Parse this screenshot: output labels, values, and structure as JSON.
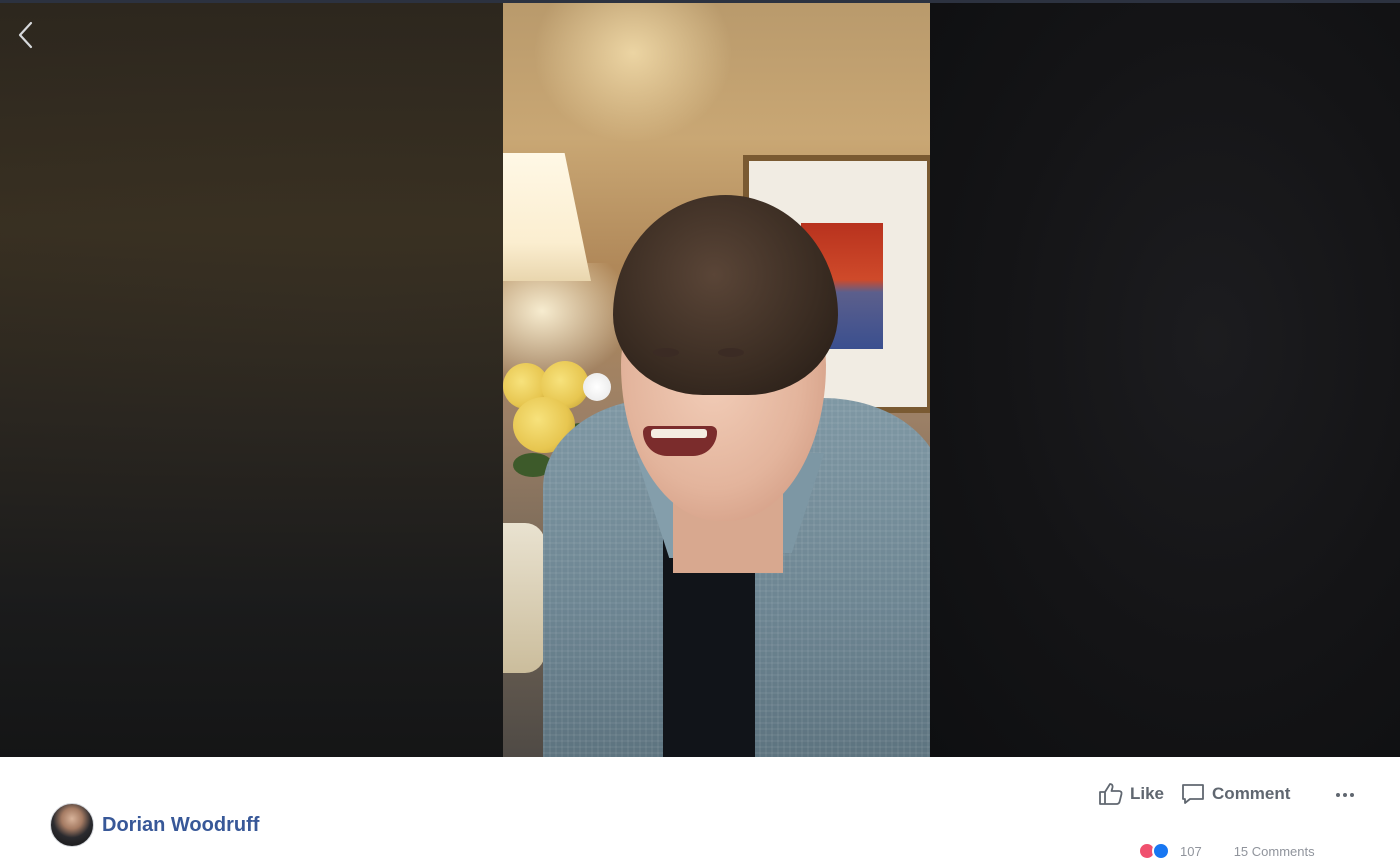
{
  "post": {
    "author_name": "Dorian Woodruff",
    "actions": {
      "like_label": "Like",
      "comment_label": "Comment"
    },
    "reactions": {
      "count": "107",
      "comments": "15 Comments"
    }
  },
  "colors": {
    "link_blue": "#385898",
    "action_gray": "#606770",
    "love_red": "#f0506e",
    "like_blue": "#1877f2"
  },
  "icons": [
    "back-chevron-icon",
    "thumbs-up-icon",
    "comment-bubble-icon",
    "more-options-icon",
    "love-reaction-icon",
    "like-reaction-icon"
  ]
}
